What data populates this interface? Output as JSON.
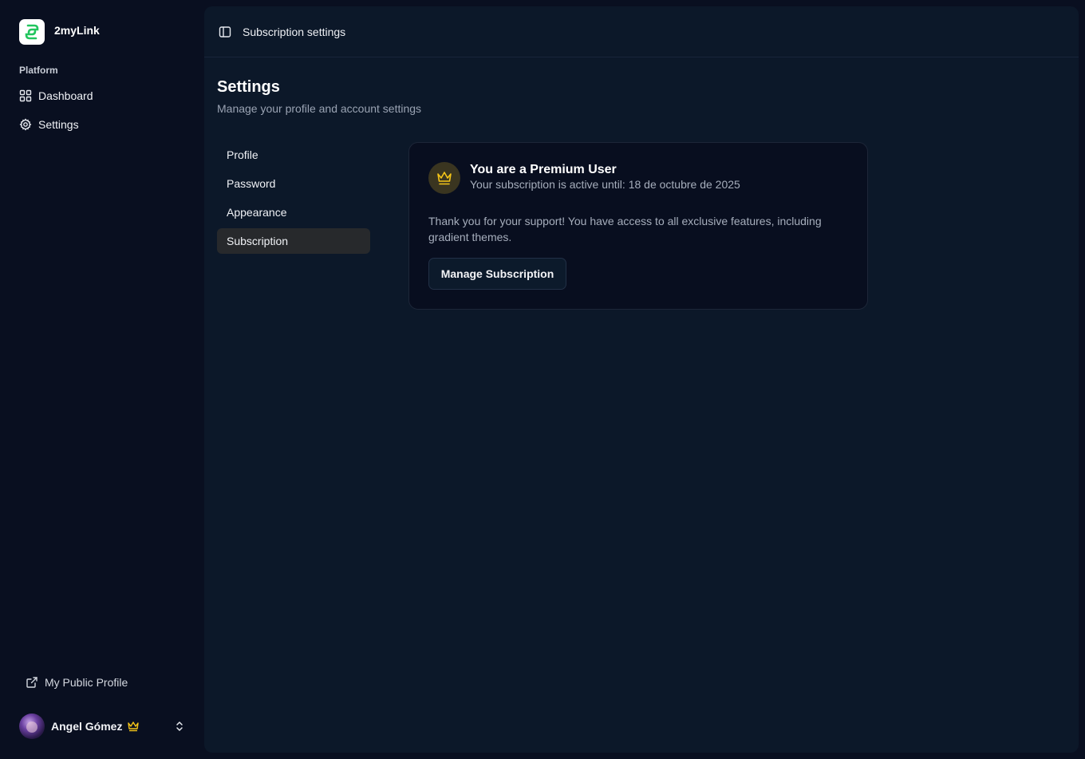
{
  "colors": {
    "accent_green": "#22c55e",
    "crown_gold": "#f5c518",
    "sidebar_bg": "#090f20",
    "panel_bg": "#0c1829",
    "card_bg": "#080e1f",
    "active_item_bg": "#27292c"
  },
  "brand": {
    "name": "2myLink",
    "logo_icon": "2mylink-logo-icon"
  },
  "sidebar": {
    "section_label": "Platform",
    "items": [
      {
        "label": "Dashboard",
        "icon": "grid-icon"
      },
      {
        "label": "Settings",
        "icon": "gear-icon"
      }
    ],
    "public_profile": {
      "label": "My Public Profile",
      "icon": "external-link-icon"
    },
    "user": {
      "name": "Angel Gómez",
      "badge_icon": "crown-icon",
      "menu_icon": "chevron-up-down-icon"
    }
  },
  "topbar": {
    "toggle_icon": "sidebar-toggle-icon",
    "title": "Subscription settings"
  },
  "page": {
    "title": "Settings",
    "subtitle": "Manage your profile and account settings"
  },
  "settings_nav": {
    "items": [
      {
        "label": "Profile",
        "active": false
      },
      {
        "label": "Password",
        "active": false
      },
      {
        "label": "Appearance",
        "active": false
      },
      {
        "label": "Subscription",
        "active": true
      }
    ]
  },
  "subscription_card": {
    "icon": "crown-icon",
    "title": "You are a Premium User",
    "active_until_line": "Your subscription is active until: 18 de octubre de 2025",
    "message": "Thank you for your support! You have access to all exclusive features, including gradient themes.",
    "manage_button": "Manage Subscription"
  }
}
